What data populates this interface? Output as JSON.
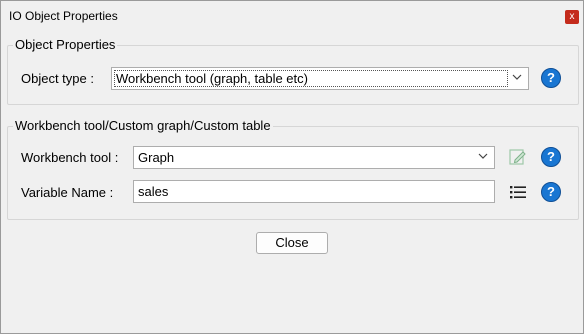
{
  "window": {
    "title": "IO Object Properties",
    "close_glyph": "x"
  },
  "object_properties": {
    "group_title": "Object Properties",
    "object_type_label": "Object type :",
    "object_type_value": "Workbench tool (graph, table etc)",
    "help_glyph": "?"
  },
  "workbench_group": {
    "group_title": "Workbench tool/Custom graph/Custom table",
    "tool_label": "Workbench tool :",
    "tool_value": "Graph",
    "variable_label": "Variable Name :",
    "variable_value": "sales",
    "help_glyph": "?"
  },
  "footer": {
    "close_label": "Close"
  },
  "colors": {
    "help_blue": "#1976d2",
    "close_red": "#c42b1c",
    "edit_icon": "#9ec9a8"
  }
}
